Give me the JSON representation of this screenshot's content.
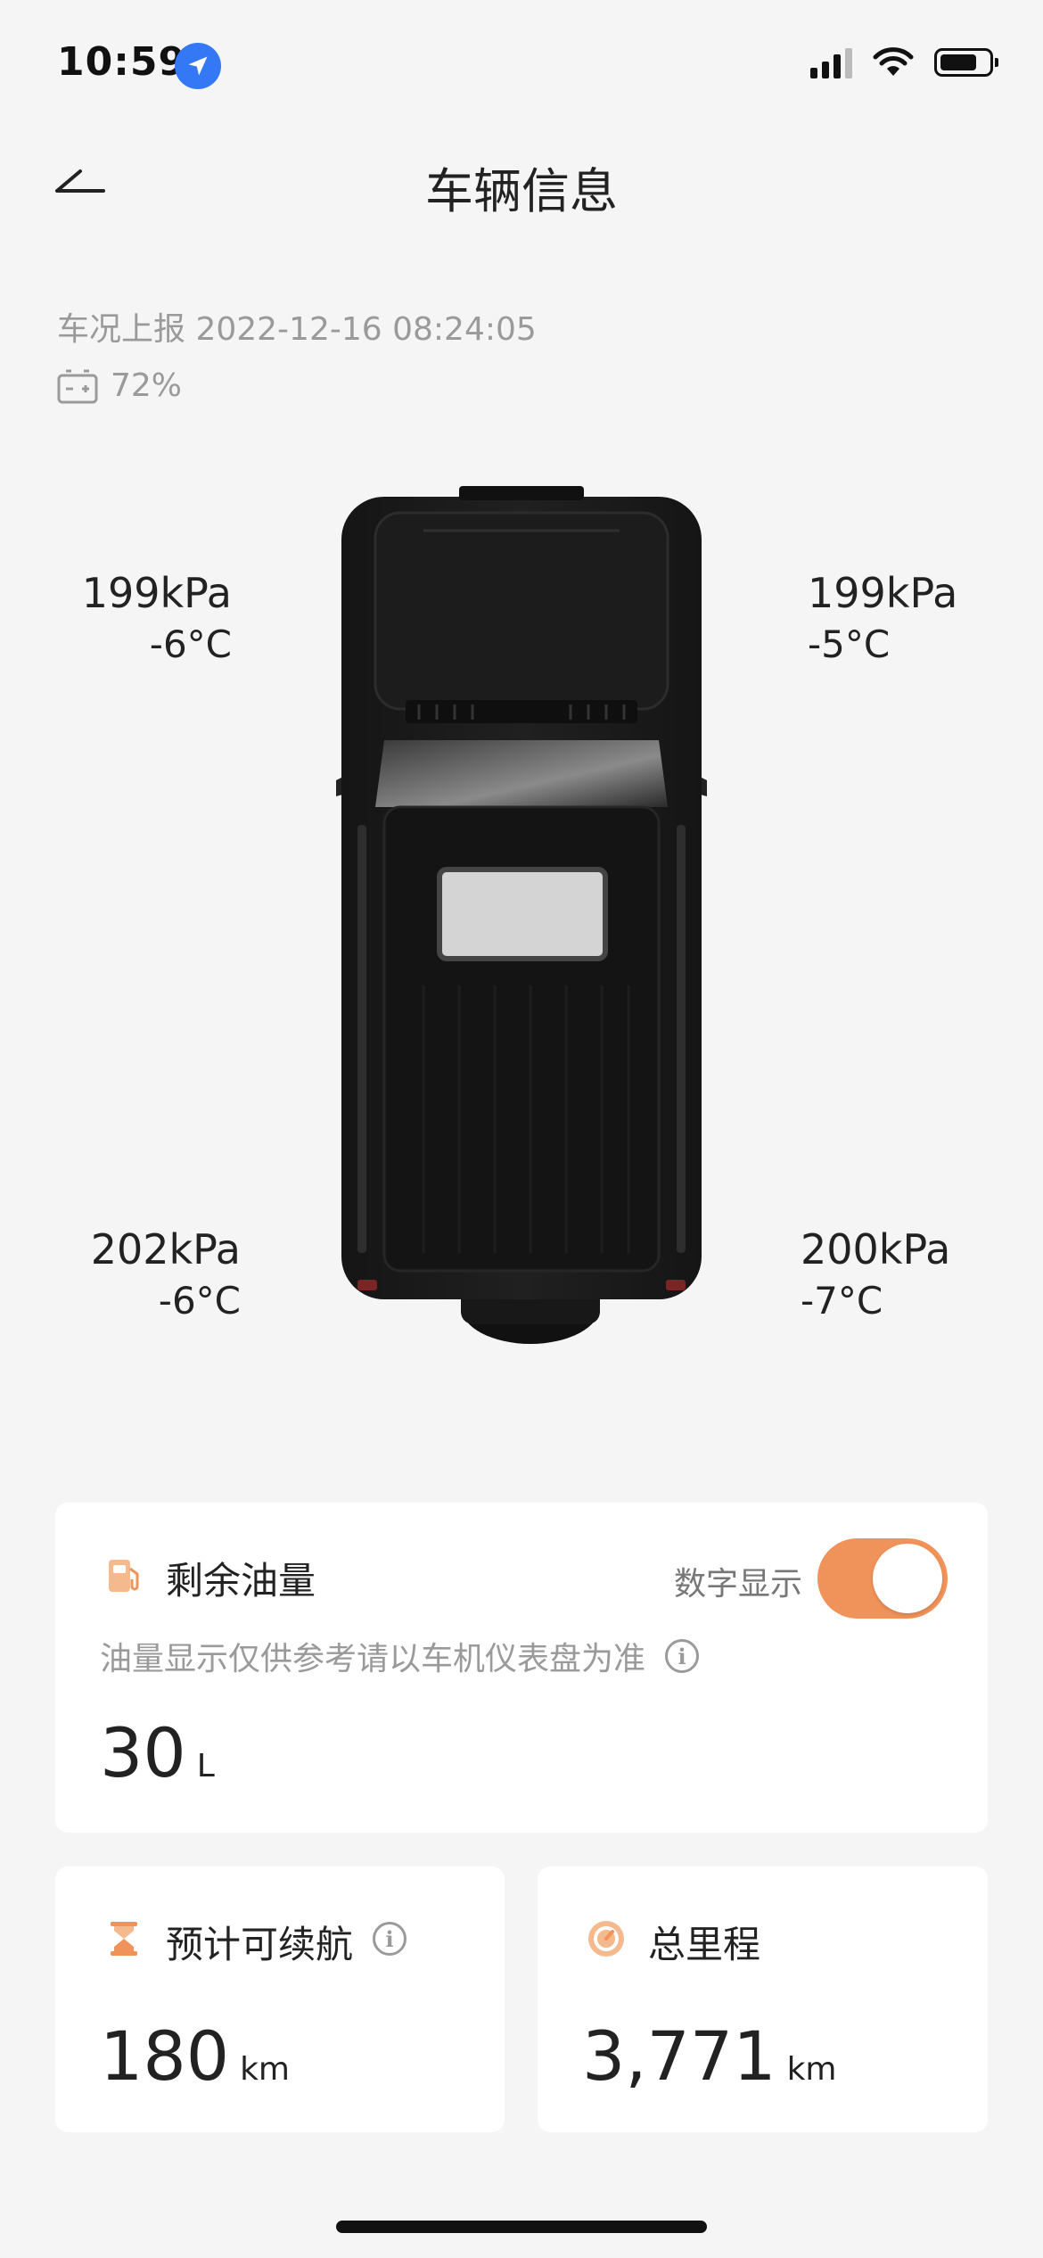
{
  "status_bar": {
    "time": "10:59"
  },
  "nav": {
    "title": "车辆信息"
  },
  "report": {
    "text": "车况上报 2022-12-16 08:24:05"
  },
  "battery": {
    "percent": "72%"
  },
  "tires": {
    "front_left": {
      "pressure": "199kPa",
      "temp": "-6°C"
    },
    "front_right": {
      "pressure": "199kPa",
      "temp": "-5°C"
    },
    "rear_left": {
      "pressure": "202kPa",
      "temp": "-6°C"
    },
    "rear_right": {
      "pressure": "200kPa",
      "temp": "-7°C"
    }
  },
  "fuel_card": {
    "title": "剩余油量",
    "toggle_label": "数字显示",
    "toggle_on": true,
    "note": "油量显示仅供参考请以车机仪表盘为准",
    "value": "30",
    "unit": "L"
  },
  "range_card": {
    "title": "预计可续航",
    "value": "180",
    "unit": "km"
  },
  "mileage_card": {
    "title": "总里程",
    "value": "3,771",
    "unit": "km"
  },
  "colors": {
    "accent": "#f0935a",
    "background": "#f5f5f5",
    "text_secondary": "#9a9a9a"
  },
  "icons": [
    "location-arrow-icon",
    "signal-icon",
    "wifi-icon",
    "battery-icon",
    "back-arrow-icon",
    "car-battery-icon",
    "fuel-pump-icon",
    "info-icon",
    "hourglass-icon",
    "odometer-icon"
  ]
}
